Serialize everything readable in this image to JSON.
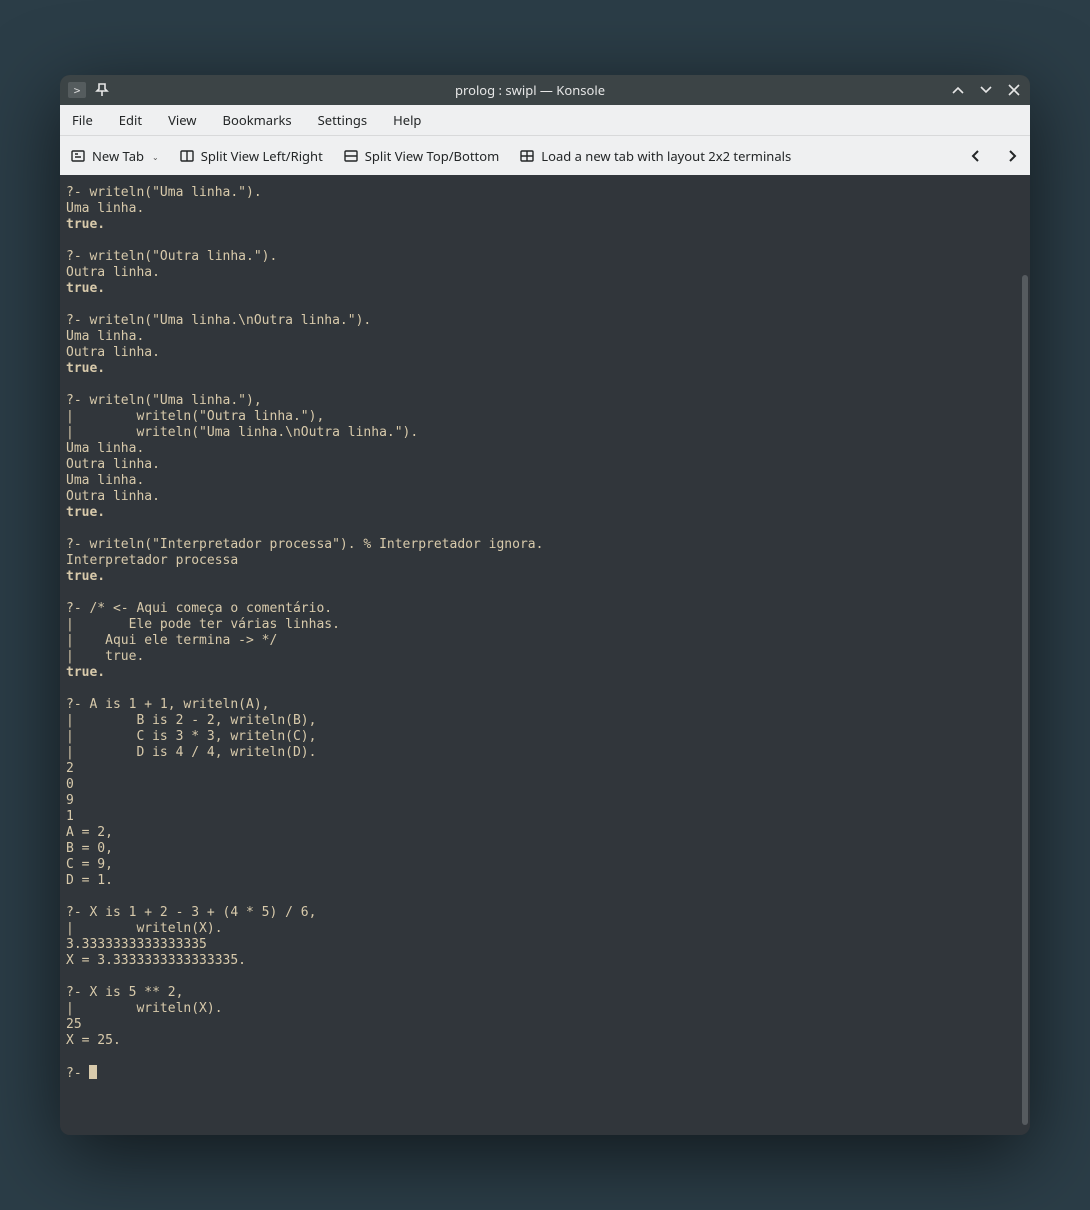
{
  "title": "prolog : swipl — Konsole",
  "menu": [
    "File",
    "Edit",
    "View",
    "Bookmarks",
    "Settings",
    "Help"
  ],
  "toolbar": {
    "new_tab": "New Tab",
    "split_lr": "Split View Left/Right",
    "split_tb": "Split View Top/Bottom",
    "layout": "Load a new tab with layout 2x2 terminals"
  },
  "terminal_lines": [
    {
      "t": "?- writeln(\"Uma linha.\")."
    },
    {
      "t": "Uma linha."
    },
    {
      "t": "true.",
      "b": true
    },
    {
      "t": ""
    },
    {
      "t": "?- writeln(\"Outra linha.\")."
    },
    {
      "t": "Outra linha."
    },
    {
      "t": "true.",
      "b": true
    },
    {
      "t": ""
    },
    {
      "t": "?- writeln(\"Uma linha.\\nOutra linha.\")."
    },
    {
      "t": "Uma linha."
    },
    {
      "t": "Outra linha."
    },
    {
      "t": "true.",
      "b": true
    },
    {
      "t": ""
    },
    {
      "t": "?- writeln(\"Uma linha.\"),"
    },
    {
      "t": "|        writeln(\"Outra linha.\"),"
    },
    {
      "t": "|        writeln(\"Uma linha.\\nOutra linha.\")."
    },
    {
      "t": "Uma linha."
    },
    {
      "t": "Outra linha."
    },
    {
      "t": "Uma linha."
    },
    {
      "t": "Outra linha."
    },
    {
      "t": "true.",
      "b": true
    },
    {
      "t": ""
    },
    {
      "t": "?- writeln(\"Interpretador processa\"). % Interpretador ignora."
    },
    {
      "t": "Interpretador processa"
    },
    {
      "t": "true.",
      "b": true
    },
    {
      "t": ""
    },
    {
      "t": "?- /* <- Aqui começa o comentário."
    },
    {
      "t": "|       Ele pode ter várias linhas."
    },
    {
      "t": "|    Aqui ele termina -> */"
    },
    {
      "t": "|    true."
    },
    {
      "t": "true.",
      "b": true
    },
    {
      "t": ""
    },
    {
      "t": "?- A is 1 + 1, writeln(A),"
    },
    {
      "t": "|        B is 2 - 2, writeln(B),"
    },
    {
      "t": "|        C is 3 * 3, writeln(C),"
    },
    {
      "t": "|        D is 4 / 4, writeln(D)."
    },
    {
      "t": "2"
    },
    {
      "t": "0"
    },
    {
      "t": "9"
    },
    {
      "t": "1"
    },
    {
      "t": "A = 2,"
    },
    {
      "t": "B = 0,"
    },
    {
      "t": "C = 9,"
    },
    {
      "t": "D = 1."
    },
    {
      "t": ""
    },
    {
      "t": "?- X is 1 + 2 - 3 + (4 * 5) / 6,"
    },
    {
      "t": "|        writeln(X)."
    },
    {
      "t": "3.3333333333333335"
    },
    {
      "t": "X = 3.3333333333333335."
    },
    {
      "t": ""
    },
    {
      "t": "?- X is 5 ** 2,"
    },
    {
      "t": "|        writeln(X)."
    },
    {
      "t": "25"
    },
    {
      "t": "X = 25."
    },
    {
      "t": ""
    }
  ],
  "prompt": "?- "
}
